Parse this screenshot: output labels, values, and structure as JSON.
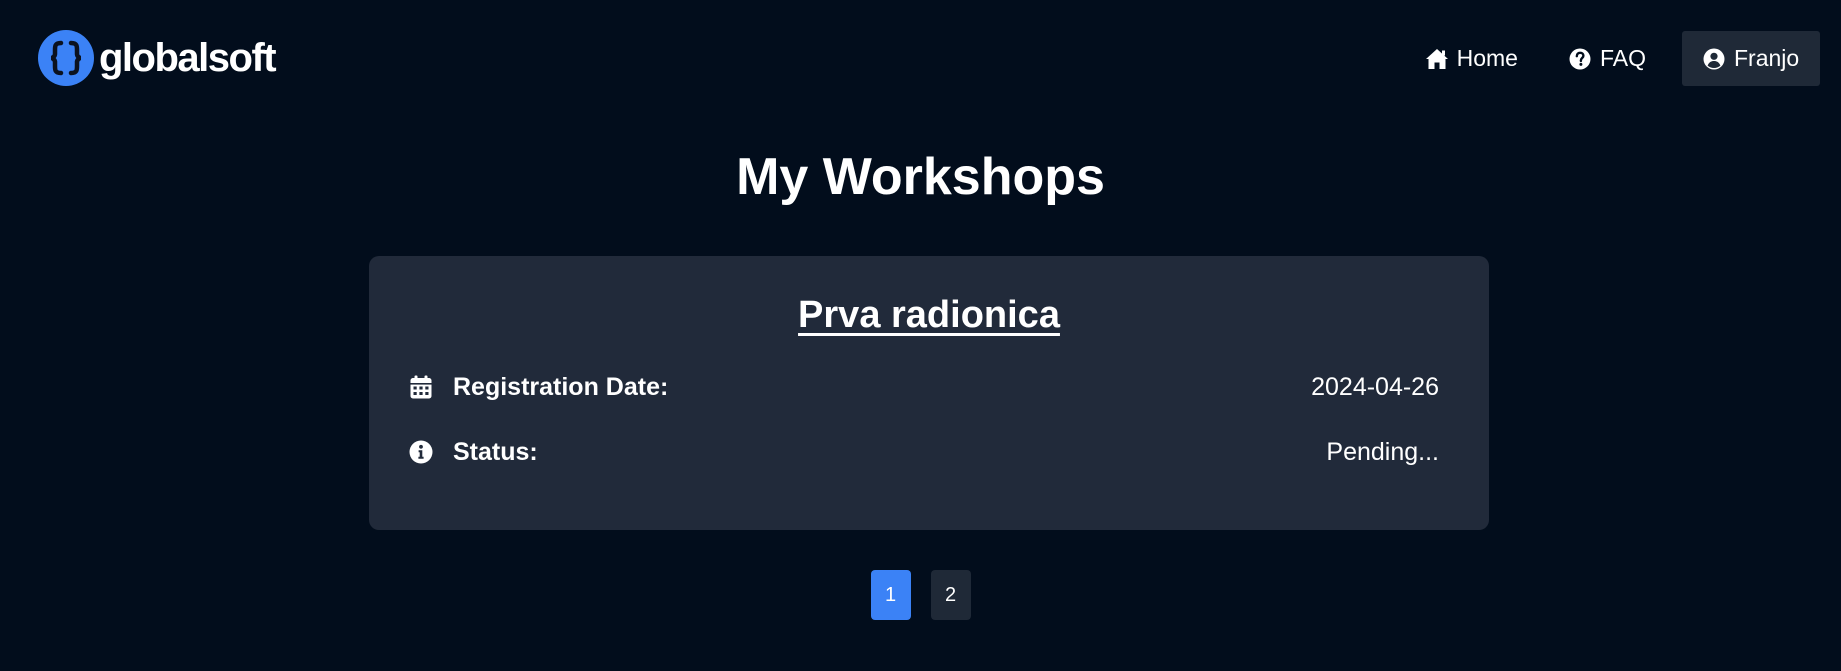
{
  "navbar": {
    "brand": {
      "name": "globalsoft",
      "logo_icon": "curly-braces-logo",
      "logo_color": "#3b82f6"
    },
    "links": [
      {
        "label": "Home",
        "icon": "home-icon"
      },
      {
        "label": "FAQ",
        "icon": "question-circle-icon"
      },
      {
        "label": "Franjo",
        "icon": "user-circle-icon"
      }
    ]
  },
  "page": {
    "title": "My Workshops"
  },
  "workshop": {
    "title": "Prva radionica",
    "registration_label": "Registration Date:",
    "registration_value": "2024-04-26",
    "status_label": "Status:",
    "status_value": "Pending..."
  },
  "pagination": {
    "pages": [
      "1",
      "2"
    ],
    "current": "1"
  },
  "colors": {
    "background": "#020d1c",
    "card": "#212a3a",
    "accent": "#3b82f6",
    "button": "#1f2937"
  }
}
